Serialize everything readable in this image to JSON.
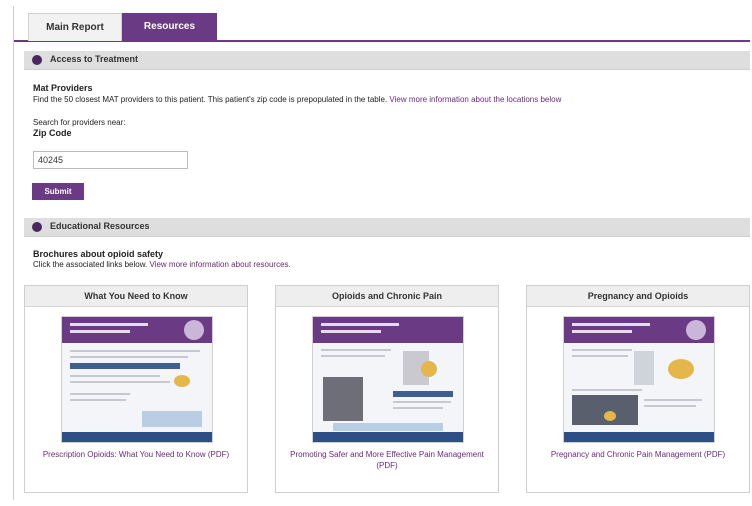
{
  "tabs": [
    {
      "label": "Main Report"
    },
    {
      "label": "Resources"
    }
  ],
  "access_section": {
    "title": "Access to Treatment",
    "map_heading": "Mat Providers",
    "description_prefix": "Find the 50 closest MAT providers to this patient. This patient's zip code is prepopulated in the table. ",
    "description_link": "View more information about the locations below",
    "search_label": "Search for providers near:",
    "zip_label": "Zip Code",
    "zip_value": "40245",
    "submit_label": "Submit"
  },
  "resources_section": {
    "title": "Educational Resources",
    "subheading": "Brochures about opioid safety",
    "note_prefix": "Click the associated links below. ",
    "note_link": "View more information about resources."
  },
  "cards": [
    {
      "title": "What You Need to Know",
      "caption": "Prescription Opioids: What You Need to Know (PDF)",
      "icon": "brochure-thumbnail"
    },
    {
      "title": "Opioids and Chronic Pain",
      "caption": "Promoting Safer and More Effective Pain Management (PDF)",
      "icon": "brochure-thumbnail"
    },
    {
      "title": "Pregnancy and Opioids",
      "caption": "Pregnancy and Chronic Pain Management (PDF)",
      "icon": "brochure-thumbnail"
    }
  ],
  "colors": {
    "brand": "#6a3a84",
    "link": "#6a2a7a",
    "section_bg": "#dedede"
  }
}
